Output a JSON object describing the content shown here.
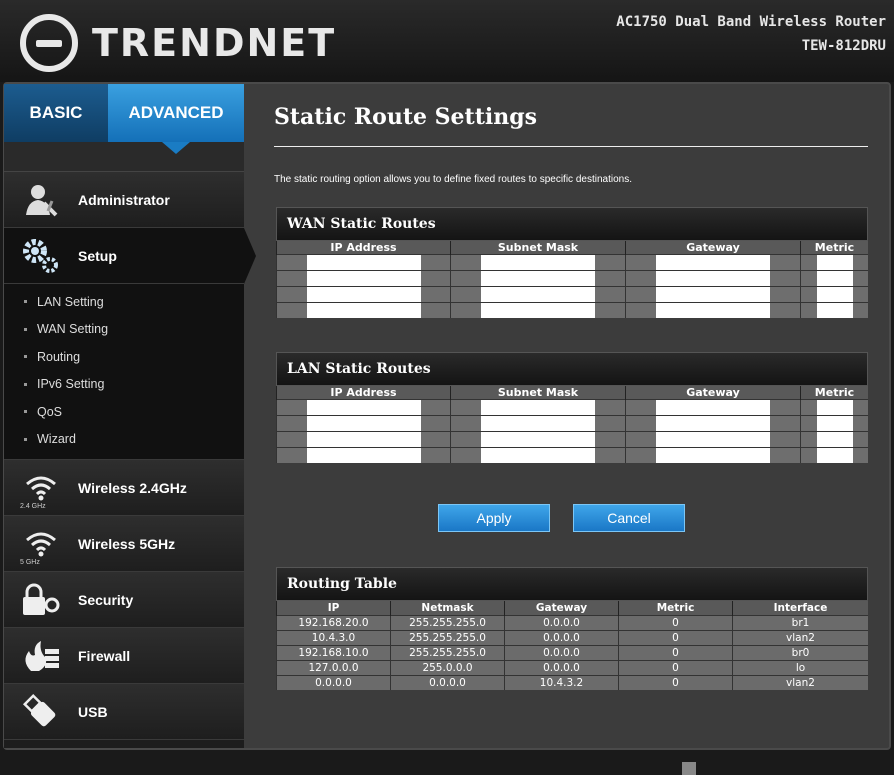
{
  "header": {
    "brand": "TRENDnet",
    "product_line1": "AC1750 Dual Band Wireless Router",
    "product_line2": "TEW-812DRU"
  },
  "sidebar": {
    "mode_tabs": [
      {
        "label": "BASIC",
        "active": false
      },
      {
        "label": "ADVANCED",
        "active": true
      }
    ],
    "items": [
      {
        "label": "Administrator",
        "icon": "administrator-icon"
      },
      {
        "label": "Setup",
        "icon": "gears-icon",
        "active": true
      },
      {
        "label": "Wireless 2.4GHz",
        "icon": "wifi-icon",
        "badge": "2.4 GHz"
      },
      {
        "label": "Wireless 5GHz",
        "icon": "wifi-icon",
        "badge": "5 GHz"
      },
      {
        "label": "Security",
        "icon": "lock-icon"
      },
      {
        "label": "Firewall",
        "icon": "firewall-icon"
      },
      {
        "label": "USB",
        "icon": "usb-icon"
      }
    ],
    "setup_submenu": [
      "LAN Setting",
      "WAN Setting",
      "Routing",
      "IPv6 Setting",
      "QoS",
      "Wizard"
    ]
  },
  "main": {
    "title": "Static Route Settings",
    "intro": "The static routing option allows you to define fixed routes to specific destinations.",
    "wan_section": {
      "title": "WAN Static Routes",
      "columns": [
        "IP Address",
        "Subnet Mask",
        "Gateway",
        "Metric"
      ],
      "row_count": 4
    },
    "lan_section": {
      "title": "LAN Static Routes",
      "columns": [
        "IP Address",
        "Subnet Mask",
        "Gateway",
        "Metric"
      ],
      "row_count": 4
    },
    "buttons": {
      "apply": "Apply",
      "cancel": "Cancel"
    },
    "routing_table": {
      "title": "Routing Table",
      "columns": [
        "IP",
        "Netmask",
        "Gateway",
        "Metric",
        "Interface"
      ],
      "rows": [
        [
          "192.168.20.0",
          "255.255.255.0",
          "0.0.0.0",
          "0",
          "br1"
        ],
        [
          "10.4.3.0",
          "255.255.255.0",
          "0.0.0.0",
          "0",
          "vlan2"
        ],
        [
          "192.168.10.0",
          "255.255.255.0",
          "0.0.0.0",
          "0",
          "br0"
        ],
        [
          "127.0.0.0",
          "255.0.0.0",
          "0.0.0.0",
          "0",
          "lo"
        ],
        [
          "0.0.0.0",
          "0.0.0.0",
          "10.4.3.2",
          "0",
          "vlan2"
        ]
      ]
    }
  },
  "colors": {
    "accent": "#1a7cc4",
    "panel": "#3c3c3c",
    "sidebar": "#1d1d1d"
  }
}
